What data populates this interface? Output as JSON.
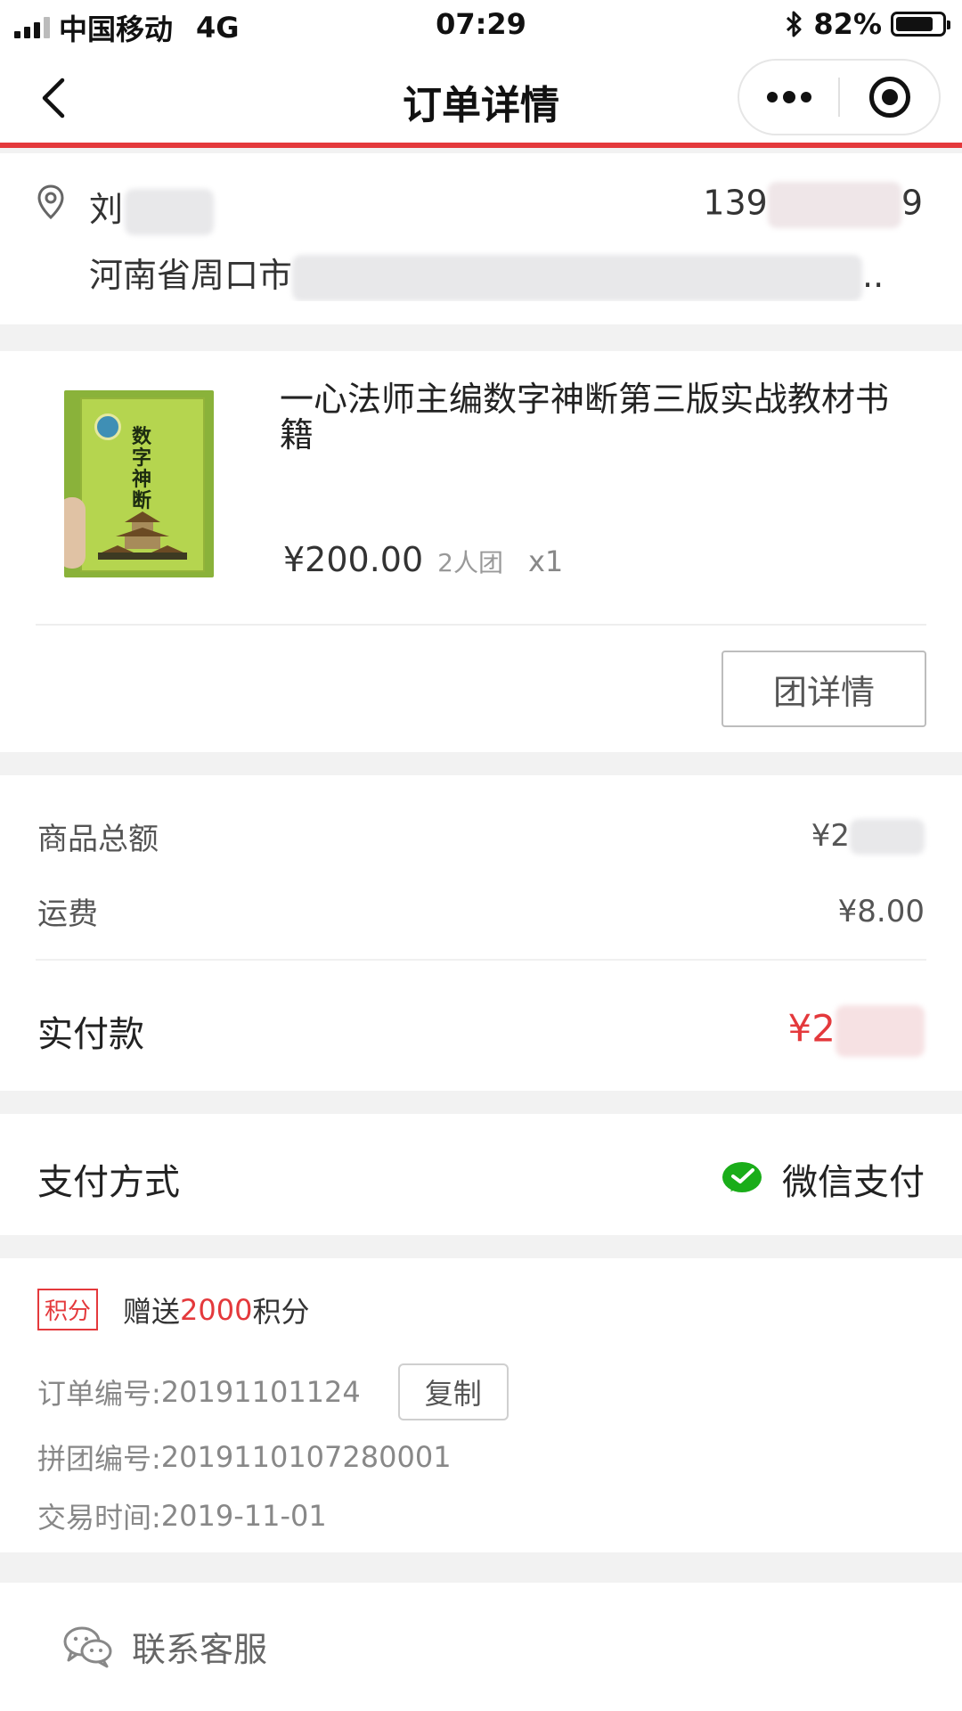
{
  "status_bar": {
    "carrier": "中国移动",
    "network": "4G",
    "time": "07:29",
    "battery": "82%",
    "battery_level": 0.82,
    "icons": [
      "signal-icon",
      "bluetooth-icon",
      "battery-icon"
    ]
  },
  "nav": {
    "title": "订单详情",
    "icons": [
      "back-icon",
      "more-icon",
      "close-miniprogram-icon"
    ]
  },
  "address": {
    "name": "刘",
    "phone_prefix": "139",
    "phone_suffix": "9",
    "address_prefix": "河南省周口市",
    "ellipsis": "..",
    "icon": "location-pin-icon"
  },
  "product": {
    "title": "一心法师主编数字神断第三版实战教材书籍",
    "price": "¥200.00",
    "group": "2人团",
    "qty": "x1",
    "cover_title": "数字神断",
    "group_detail_button": "团详情"
  },
  "summary": {
    "goods_total_label": "商品总额",
    "goods_total_value": "¥2",
    "shipping_label": "运费",
    "shipping_value": "¥8.00",
    "paid_label": "实付款",
    "paid_value": "¥2"
  },
  "payment": {
    "label": "支付方式",
    "method": "微信支付",
    "icon": "wechat-pay-icon"
  },
  "info": {
    "points_tag": "积分",
    "points_prefix": "赠送",
    "points_value": "2000",
    "points_suffix": "积分",
    "order_no_label": "订单编号:",
    "order_no": "20191101124",
    "copy_button": "复制",
    "group_no_label": "拼团编号:",
    "group_no": "2019110107280001",
    "time_label": "交易时间:",
    "time": "2019-11-01"
  },
  "service": {
    "label": "联系客服",
    "icon": "chat-icon"
  },
  "colors": {
    "accent": "#e4393c",
    "wechat": "#1aad19",
    "background": "#f2f2f2"
  }
}
